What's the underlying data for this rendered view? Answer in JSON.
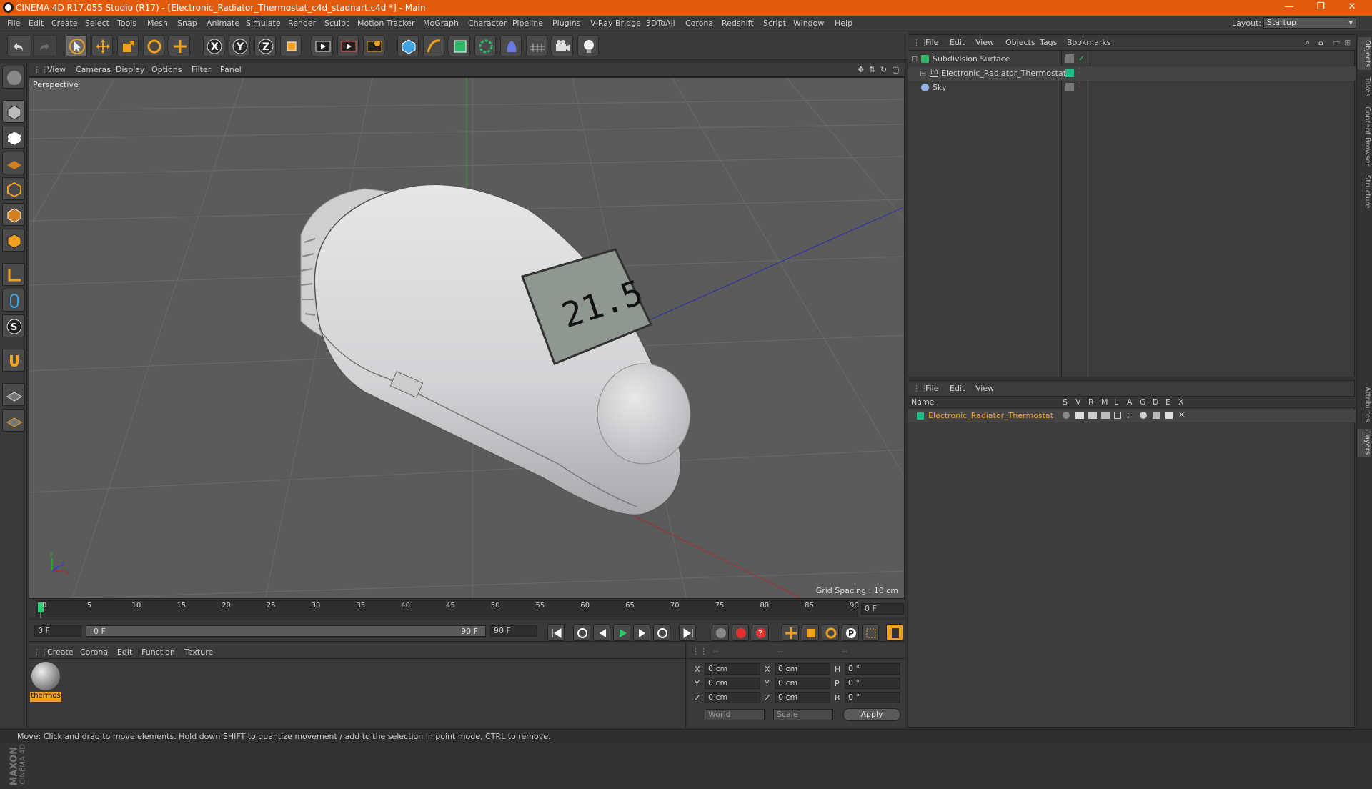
{
  "window": {
    "title": "CINEMA 4D R17.055 Studio (R17) - [Electronic_Radiator_Thermostat_c4d_stadnart.c4d *] - Main",
    "controls": {
      "minimize": "—",
      "restore": "❐",
      "close": "✕"
    }
  },
  "menubar": {
    "items": [
      "File",
      "Edit",
      "Create",
      "Select",
      "Tools",
      "Mesh",
      "Snap",
      "Animate",
      "Simulate",
      "Render",
      "Sculpt",
      "Motion Tracker",
      "MoGraph",
      "Character",
      "Pipeline",
      "Plugins",
      "V-Ray Bridge",
      "3DToAll",
      "Corona",
      "Redshift",
      "Script",
      "Window",
      "Help"
    ],
    "layout_label": "Layout:",
    "layout_value": "Startup"
  },
  "viewport": {
    "menu": [
      "View",
      "Cameras",
      "Display",
      "Options",
      "Filter",
      "Panel"
    ],
    "label": "Perspective",
    "grid_spacing": "Grid Spacing : 10 cm",
    "display_digits": "21.5",
    "axis_labels": {
      "x": "x",
      "y": "y",
      "z": "z"
    }
  },
  "timeline": {
    "ticks": [
      "0",
      "5",
      "10",
      "15",
      "20",
      "25",
      "30",
      "35",
      "40",
      "45",
      "50",
      "55",
      "60",
      "65",
      "70",
      "75",
      "80",
      "85",
      "90"
    ],
    "current_frame": "0 F",
    "start_field": "0 F",
    "range_start": "0 F",
    "range_end": "90 F",
    "end_field": "90 F"
  },
  "material_panel": {
    "menu": [
      "Create",
      "Corona",
      "Edit",
      "Function",
      "Texture"
    ],
    "materials": [
      {
        "name": "thermos"
      }
    ]
  },
  "coordinates": {
    "headers": [
      "--",
      "--",
      "--"
    ],
    "rows": [
      {
        "a": "X",
        "av": "0 cm",
        "b": "X",
        "bv": "0 cm",
        "c": "H",
        "cv": "0 °"
      },
      {
        "a": "Y",
        "av": "0 cm",
        "b": "Y",
        "bv": "0 cm",
        "c": "P",
        "cv": "0 °"
      },
      {
        "a": "Z",
        "av": "0 cm",
        "b": "Z",
        "bv": "0 cm",
        "c": "B",
        "cv": "0 °"
      }
    ],
    "mode1": "World",
    "mode2": "Scale",
    "apply": "Apply"
  },
  "object_manager": {
    "menu": [
      "File",
      "Edit",
      "View",
      "Objects",
      "Tags",
      "Bookmarks"
    ],
    "objects": [
      {
        "name": "Subdivision Surface",
        "indent": 0
      },
      {
        "name": "Electronic_Radiator_Thermostat",
        "indent": 1
      },
      {
        "name": "Sky",
        "indent": 0
      }
    ]
  },
  "layer_manager": {
    "menu": [
      "File",
      "Edit",
      "View"
    ],
    "columns": [
      "Name",
      "S",
      "V",
      "R",
      "M",
      "L",
      "A",
      "G",
      "D",
      "E",
      "X"
    ],
    "layers": [
      {
        "name": "Electronic_Radiator_Thermostat",
        "color": "#1fbf8a"
      }
    ]
  },
  "right_tabs": [
    "Objects",
    "Takes",
    "Content Browser",
    "Structure",
    "Attributes",
    "Layers"
  ],
  "status": "Move: Click and drag to move elements. Hold down SHIFT to quantize movement / add to the selection in point mode, CTRL to remove.",
  "brand": {
    "line1": "MAXON",
    "line2": "CINEMA 4D"
  },
  "colors": {
    "title_bar": "#e25a0c",
    "accent_orange": "#f08a00",
    "layer_green": "#1fbf8a"
  }
}
